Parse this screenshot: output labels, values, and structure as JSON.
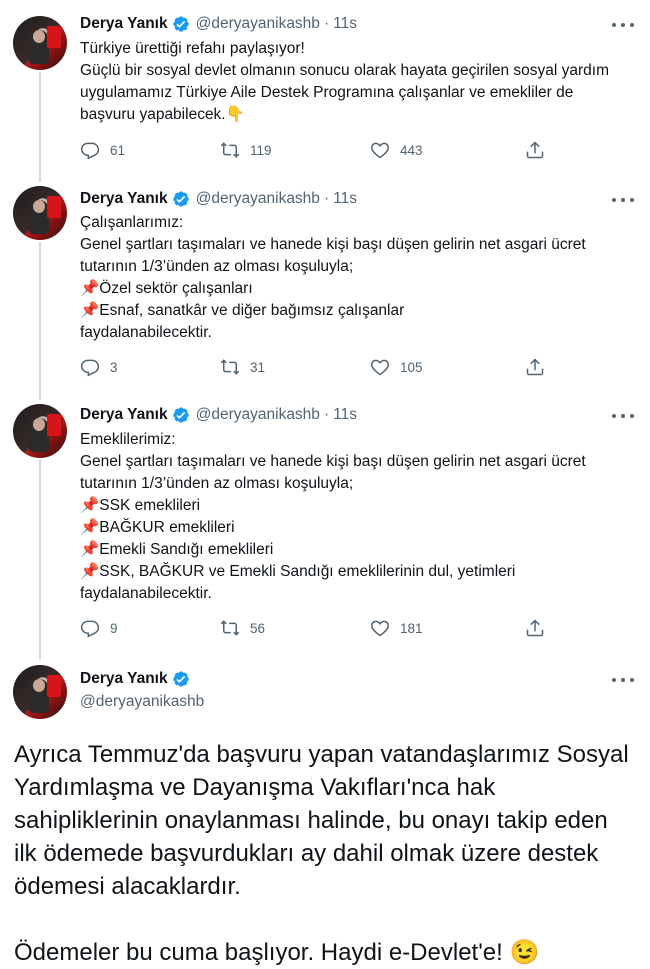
{
  "colors": {
    "verified": "#1d9bf0",
    "muted": "#536471",
    "text": "#0f1419",
    "line": "#cfd9de"
  },
  "tweets": [
    {
      "name": "Derya Yanık",
      "handle": "@deryayanikashb",
      "dot": "·",
      "time": "11s",
      "text": "Türkiye ürettiği refahı paylaşıyor!\nGüçlü bir sosyal devlet olmanın sonucu olarak hayata geçirilen sosyal yardım uygulamamız Türkiye Aile Destek Programına çalışanlar ve emekliler de başvuru yapabilecek.👇",
      "replies": "61",
      "retweets": "119",
      "likes": "443"
    },
    {
      "name": "Derya Yanık",
      "handle": "@deryayanikashb",
      "dot": "·",
      "time": "11s",
      "text": "Çalışanlarımız:\nGenel şartları taşımaları ve hanede kişi başı düşen gelirin net asgari ücret tutarının 1/3’ünden az olması koşuluyla;\n📌Özel sektör çalışanları\n📌Esnaf, sanatkâr ve diğer bağımsız çalışanlar\nfaydalanabilecektir.",
      "replies": "3",
      "retweets": "31",
      "likes": "105"
    },
    {
      "name": "Derya Yanık",
      "handle": "@deryayanikashb",
      "dot": "·",
      "time": "11s",
      "text": "Emeklilerimiz:\nGenel şartları taşımaları ve hanede kişi başı düşen gelirin net asgari ücret tutarının 1/3’ünden az olması koşuluyla;\n📌SSK emeklileri\n📌BAĞKUR emeklileri\n📌Emekli Sandığı emeklileri\n📌SSK, BAĞKUR ve Emekli Sandığı emeklilerinin dul, yetimleri\nfaydalanabilecektir.",
      "replies": "9",
      "retweets": "56",
      "likes": "181"
    }
  ],
  "main_tweet": {
    "name": "Derya Yanık",
    "handle": "@deryayanikashb",
    "text": "Ayrıca Temmuz'da başvuru yapan vatandaşlarımız Sosyal Yardımlaşma ve Dayanışma Vakıfları'nca hak sahipliklerinin onaylanması halinde, bu onayı takip eden ilk ödemede başvurdukları ay dahil olmak üzere destek ödemesi alacaklardır.\n\nÖdemeler bu cuma başlıyor. Haydi e-Devlet'e! 😉"
  }
}
